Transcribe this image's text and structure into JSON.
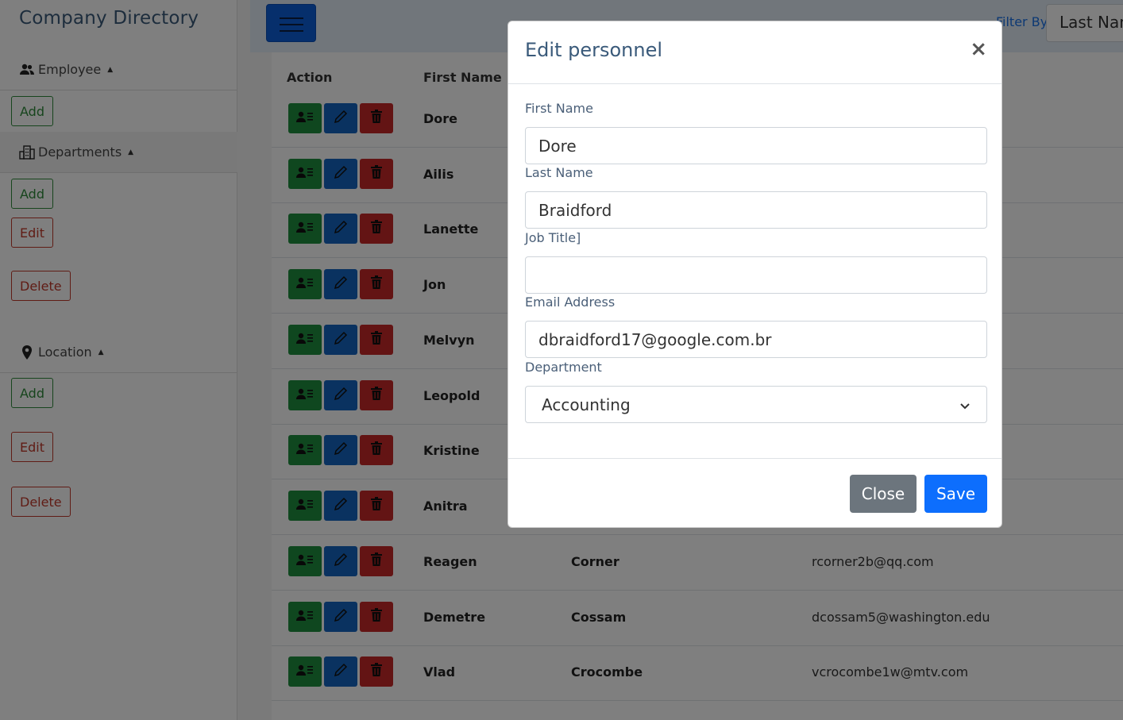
{
  "sidebar": {
    "title": "Company Directory",
    "employee": {
      "label": "Employee",
      "add": "Add"
    },
    "departments": {
      "label": "Departments",
      "add": "Add",
      "edit": "Edit",
      "delete": "Delete"
    },
    "location": {
      "label": "Location",
      "add": "Add",
      "edit": "Edit",
      "delete": "Delete"
    }
  },
  "topbar": {
    "filter_label": "Filter By",
    "filter_value": "Last Name"
  },
  "table": {
    "headers": {
      "action": "Action",
      "first": "First Name"
    },
    "rows": [
      {
        "first": "Dore",
        "last": "",
        "email": ""
      },
      {
        "first": "Ailis",
        "last": "",
        "email": ""
      },
      {
        "first": "Lanette",
        "last": "",
        "email": ""
      },
      {
        "first": "Jon",
        "last": "",
        "email": ""
      },
      {
        "first": "Melvyn",
        "last": "",
        "email": ""
      },
      {
        "first": "Leopold",
        "last": "",
        "email": ""
      },
      {
        "first": "Kristine",
        "last": "",
        "email": ""
      },
      {
        "first": "Anitra",
        "last": "",
        "email": ""
      },
      {
        "first": "Reagen",
        "last": "Corner",
        "email": "rcorner2b@qq.com"
      },
      {
        "first": "Demetre",
        "last": "Cossam",
        "email": "dcossam5@washington.edu"
      },
      {
        "first": "Vlad",
        "last": "Crocombe",
        "email": "vcrocombe1w@mtv.com"
      }
    ]
  },
  "modal": {
    "title": "Edit personnel",
    "close_symbol": "×",
    "first_name": {
      "label": "First Name",
      "value": "Dore"
    },
    "last_name": {
      "label": "Last Name",
      "value": "Braidford"
    },
    "job_title": {
      "label": "Job Title]",
      "value": ""
    },
    "email": {
      "label": "Email Address",
      "value": "dbraidford17@google.com.br"
    },
    "department": {
      "label": "Department",
      "value": "Accounting"
    },
    "close_button": "Close",
    "save_button": "Save"
  },
  "colors": {
    "primary": "#0d6efd",
    "secondary": "#6c757d",
    "view": "#1e8e3e",
    "edit": "#1565c0",
    "delete": "#c62828"
  }
}
